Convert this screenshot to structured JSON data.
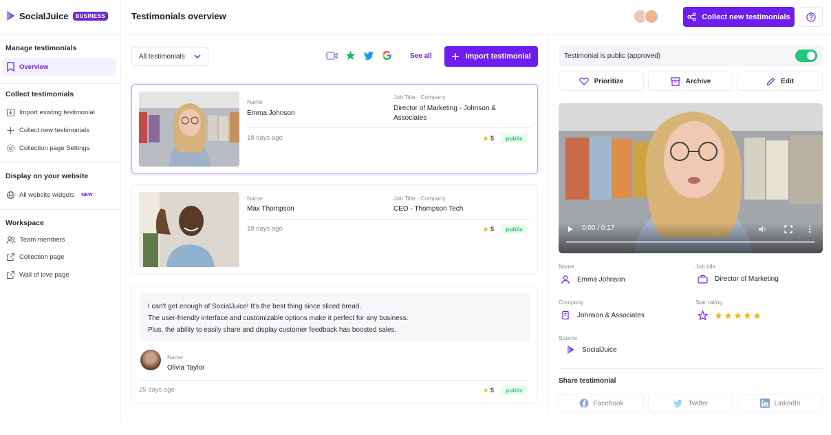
{
  "brand": {
    "name": "SocialJuice",
    "badge": "BUSINESS"
  },
  "header": {
    "title": "Testimonials overview",
    "collect_button": "Collect new testimonials"
  },
  "sidebar": {
    "sections": [
      {
        "title": "Manage testimonials",
        "items": [
          {
            "label": "Overview",
            "icon": "bookmark-icon",
            "active": true
          }
        ]
      },
      {
        "title": "Collect testimonials",
        "items": [
          {
            "label": "Import existing testimonial",
            "icon": "import-icon"
          },
          {
            "label": "Collect new testimonials",
            "icon": "plus-icon"
          },
          {
            "label": "Collection page Settings",
            "icon": "gear-icon"
          }
        ]
      },
      {
        "title": "Display on your website",
        "items": [
          {
            "label": "All website widgets",
            "icon": "globe-icon",
            "badge": "NEW"
          }
        ]
      },
      {
        "title": "Workspace",
        "items": [
          {
            "label": "Team members",
            "icon": "users-icon"
          },
          {
            "label": "Collection page",
            "icon": "external-link-icon"
          },
          {
            "label": "Wall of love page",
            "icon": "external-link-icon"
          }
        ]
      }
    ]
  },
  "toolbar": {
    "filter_label": "All testimonials",
    "see_all": "See all",
    "import_button": "Import testimonial"
  },
  "cards": [
    {
      "name_label": "Name",
      "name": "Emma Johnson",
      "job_label": "Job Title - Company",
      "job_line1": "Director of Marketing - Johnson &",
      "job_line2": "Associates",
      "ago": "18 days ago",
      "rating": "5",
      "status": "public"
    },
    {
      "name_label": "Name",
      "name": "Max Thompson",
      "job_label": "Job Title - Company",
      "job_line1": "CEO - Thompson Tech",
      "ago": "18 days ago",
      "rating": "5",
      "status": "public"
    },
    {
      "quote_line1": "I can't get enough of SocialJuice! It's the best thing since sliced bread.",
      "quote_line2": "The user-friendly interface and customizable options make it perfect for any business.",
      "quote_line3": "Plus, the ability to easily share and display customer feedback has boosted sales.",
      "name_label": "Name",
      "name": "Olivia Taylor",
      "ago": "25 days ago",
      "rating": "5",
      "status": "public"
    }
  ],
  "detail": {
    "public_text": "Testimonial is public (approved)",
    "actions": {
      "prioritize": "Prioritize",
      "archive": "Archive",
      "edit": "Edit"
    },
    "video_time": "0:00 / 0:17",
    "name_label": "Name",
    "name": "Emma Johnson",
    "job_label": "Job title",
    "job": "Director of Marketing",
    "company_label": "Company",
    "company": "Johnson & Associates",
    "rating_label": "Star rating",
    "rating_value": 5,
    "source_label": "Source",
    "source": "SocialJuice",
    "share_title": "Share testimonial",
    "share": {
      "facebook": "Facebook",
      "twitter": "Twitter",
      "linkedin": "LinkedIn"
    }
  },
  "colors": {
    "accent": "#6d1df0",
    "success": "#1fc77a",
    "star": "#f5b800"
  }
}
